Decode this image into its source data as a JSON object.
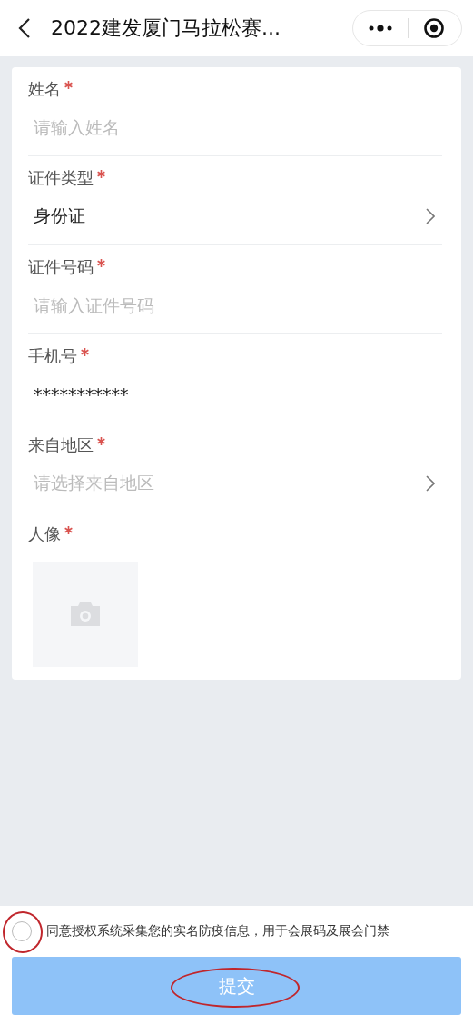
{
  "nav_bar": {
    "title": "2022建发厦门马拉松赛..."
  },
  "fields": [
    {
      "kind": "text",
      "label": "姓名",
      "required": true,
      "placeholder": "请输入姓名"
    },
    {
      "kind": "select",
      "label": "证件类型",
      "required": true,
      "value": "身份证"
    },
    {
      "kind": "text",
      "label": "证件号码",
      "required": true,
      "placeholder": "请输入证件号码"
    },
    {
      "kind": "text",
      "label": "手机号",
      "required": true,
      "value": "***********"
    },
    {
      "kind": "select",
      "label": "来自地区",
      "required": true,
      "placeholder": "请选择来自地区"
    },
    {
      "kind": "photo",
      "label": "人像",
      "required": true
    }
  ],
  "consent": {
    "checked": false,
    "text": "同意授权系统采集您的实名防疫信息，用于会展码及展会门禁"
  },
  "submit_button": {
    "label": "提交",
    "disabled": true
  }
}
